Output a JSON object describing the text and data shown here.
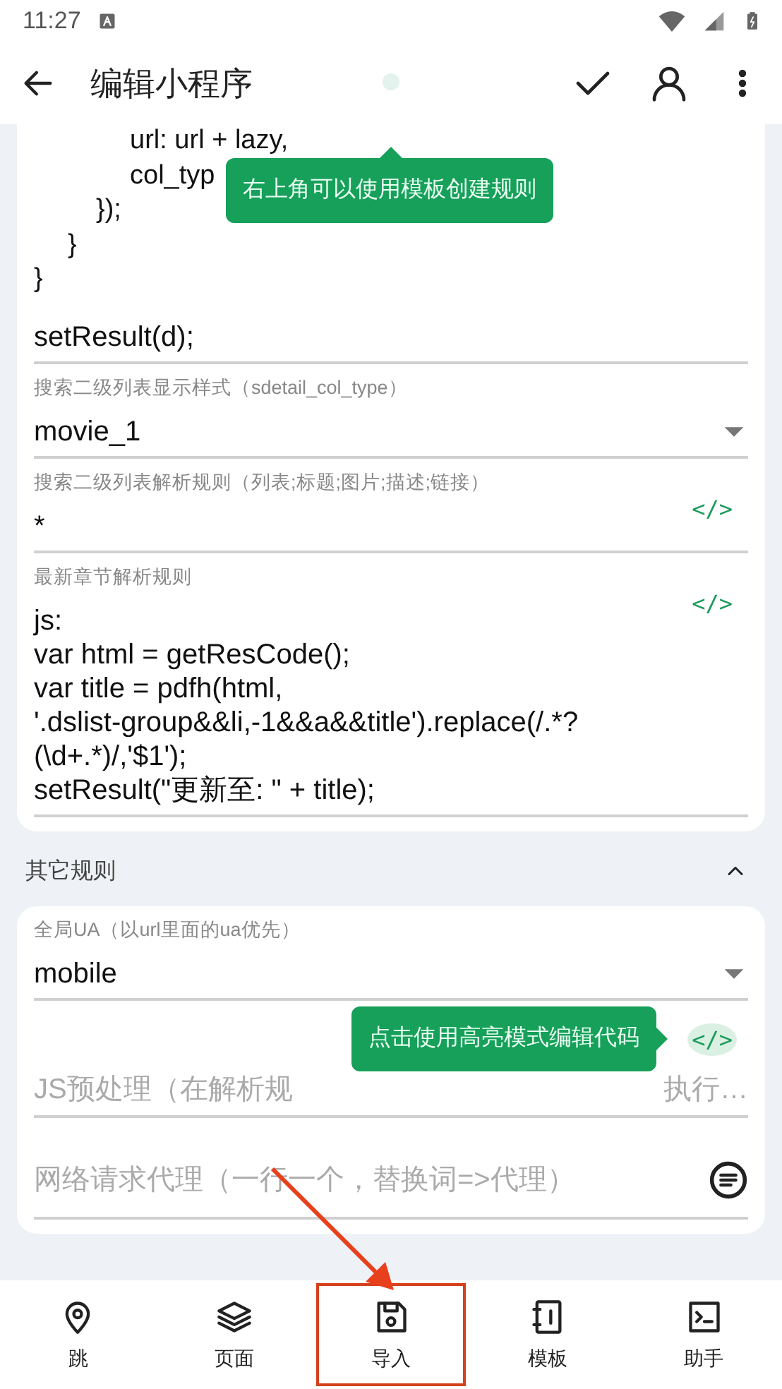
{
  "status_bar": {
    "time": "11:27"
  },
  "app_bar": {
    "title": "编辑小程序"
  },
  "code_block": {
    "lines": [
      "url: url + lazy,",
      "col_typ",
      "});",
      "}",
      "}"
    ],
    "tail": "setResult(d);"
  },
  "fields": [
    {
      "kind": "select",
      "label": "搜索二级列表显示样式（sdetail_col_type）",
      "value": "movie_1"
    },
    {
      "kind": "code",
      "label": "搜索二级列表解析规则（列表;标题;图片;描述;链接）",
      "value": "*",
      "icon_text": "</>"
    },
    {
      "kind": "code",
      "label": "最新章节解析规则",
      "value": "js:\nvar html = getResCode();\nvar title = pdfh(html,\n'.dslist-group&&li,-1&&a&&title').replace(/.*?\n(\\d+.*)/,'$1');\nsetResult(\"更新至: \" + title);",
      "icon_text": "</>"
    }
  ],
  "section": {
    "title": "其它规则",
    "expanded": true
  },
  "other_fields": [
    {
      "kind": "select",
      "label": "全局UA（以url里面的ua优先）",
      "value": "mobile"
    },
    {
      "kind": "code_placeholder",
      "placeholder": "JS预处理（在解析规",
      "placeholder_tail": "执行…",
      "icon_text": "</>"
    },
    {
      "kind": "list_placeholder",
      "placeholder": "网络请求代理（一行一个，替换词=>代理）"
    }
  ],
  "tooltips": [
    {
      "kind": "up",
      "text": "右上角可以使用模板创建规则"
    },
    {
      "kind": "right",
      "text": "点击使用高亮模式编辑代码"
    }
  ],
  "bottom_nav": [
    {
      "label": "跳",
      "highlighted": false
    },
    {
      "label": "页面",
      "highlighted": false
    },
    {
      "label": "导入",
      "highlighted": true
    },
    {
      "label": "模板",
      "highlighted": false
    },
    {
      "label": "助手",
      "highlighted": false
    }
  ]
}
